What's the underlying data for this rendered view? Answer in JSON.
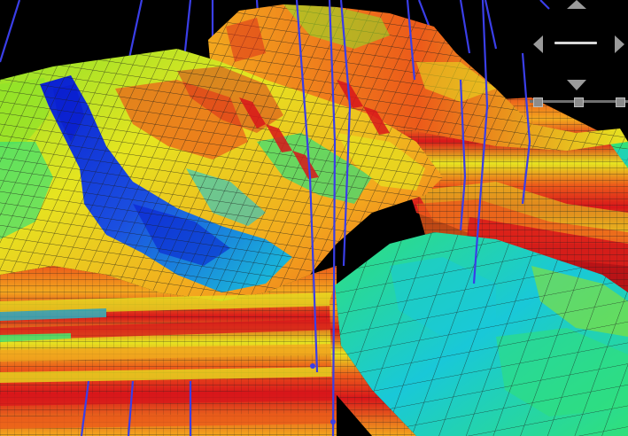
{
  "viewer": {
    "background": "#000000",
    "colormap": [
      "#0a1fd0",
      "#1b7fe8",
      "#19c8d8",
      "#30e07a",
      "#8ee32a",
      "#e6e420",
      "#f3a81e",
      "#ec5a1a",
      "#d8161a"
    ],
    "well_color": "#3a3ee8",
    "grid_line_color": "#1c1c1c"
  },
  "nav_controls": {
    "pan_up_icon": "triangle-up-icon",
    "pan_down_icon": "triangle-down-icon",
    "pan_left_icon": "triangle-left-icon",
    "pan_right_icon": "triangle-right-icon",
    "zoom_icon": "zoom-bar-icon"
  }
}
